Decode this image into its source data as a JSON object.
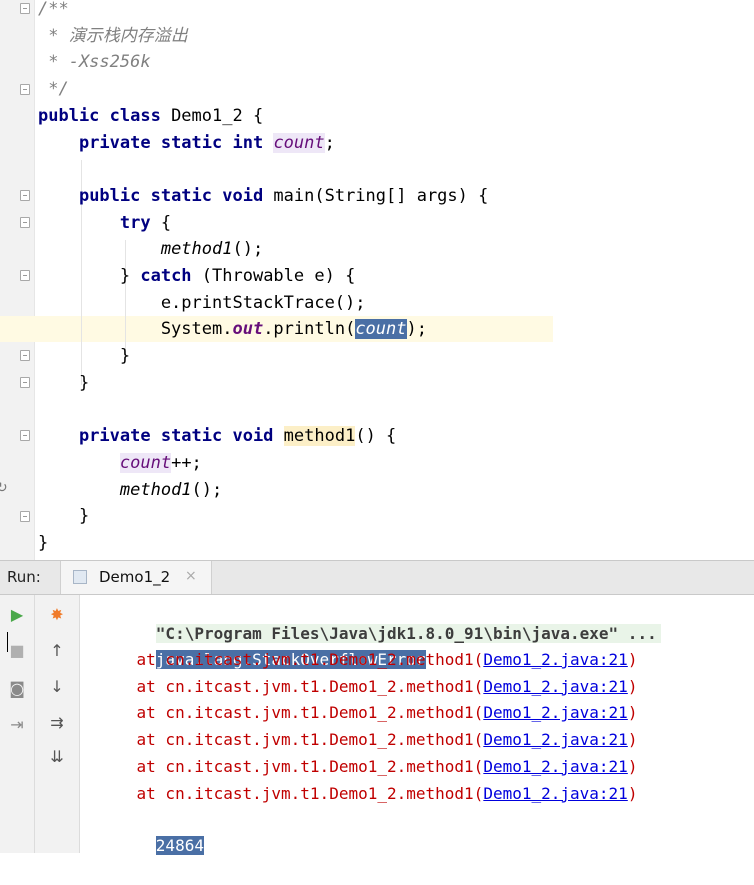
{
  "editor": {
    "lines": [
      {
        "parts": [
          {
            "t": "/**",
            "c": "cm"
          }
        ]
      },
      {
        "parts": [
          {
            "t": " * 演示栈内存溢出",
            "c": "cm"
          }
        ]
      },
      {
        "parts": [
          {
            "t": " * -Xss256k",
            "c": "cm"
          }
        ]
      },
      {
        "parts": [
          {
            "t": " */",
            "c": "cm"
          }
        ]
      },
      {
        "parts": [
          {
            "t": "public class",
            "c": "kw"
          },
          {
            "t": " Demo1_2 {",
            "c": ""
          }
        ]
      },
      {
        "parts": [
          {
            "t": "    ",
            "c": ""
          },
          {
            "t": "private static int",
            "c": "kw"
          },
          {
            "t": " ",
            "c": ""
          },
          {
            "t": "count",
            "c": "fld fld-hl"
          },
          {
            "t": ";",
            "c": ""
          }
        ]
      },
      {
        "parts": []
      },
      {
        "parts": [
          {
            "t": "    ",
            "c": ""
          },
          {
            "t": "public static void",
            "c": "kw"
          },
          {
            "t": " main(String[] args) {",
            "c": ""
          }
        ]
      },
      {
        "parts": [
          {
            "t": "        ",
            "c": ""
          },
          {
            "t": "try",
            "c": "kw"
          },
          {
            "t": " {",
            "c": ""
          }
        ]
      },
      {
        "parts": [
          {
            "t": "            ",
            "c": ""
          },
          {
            "t": "method1",
            "c": "mth"
          },
          {
            "t": "();",
            "c": ""
          }
        ]
      },
      {
        "parts": [
          {
            "t": "        } ",
            "c": ""
          },
          {
            "t": "catch",
            "c": "kw"
          },
          {
            "t": " (Throwable e) {",
            "c": ""
          }
        ]
      },
      {
        "parts": [
          {
            "t": "            e.printStackTrace();",
            "c": ""
          }
        ]
      },
      {
        "parts": [
          {
            "t": "            System.",
            "c": ""
          },
          {
            "t": "out",
            "c": "sfld"
          },
          {
            "t": ".println(",
            "c": ""
          },
          {
            "t": "count",
            "c": "sel"
          },
          {
            "t": ");",
            "c": ""
          }
        ]
      },
      {
        "parts": [
          {
            "t": "        }",
            "c": ""
          }
        ]
      },
      {
        "parts": [
          {
            "t": "    }",
            "c": ""
          }
        ]
      },
      {
        "parts": []
      },
      {
        "parts": [
          {
            "t": "    ",
            "c": ""
          },
          {
            "t": "private static void",
            "c": "kw"
          },
          {
            "t": " ",
            "c": ""
          },
          {
            "t": "method1",
            "c": "decl-hl"
          },
          {
            "t": "() {",
            "c": ""
          }
        ]
      },
      {
        "parts": [
          {
            "t": "        ",
            "c": ""
          },
          {
            "t": "count",
            "c": "fld fld-hl"
          },
          {
            "t": "++;",
            "c": ""
          }
        ]
      },
      {
        "parts": [
          {
            "t": "        ",
            "c": ""
          },
          {
            "t": "method1",
            "c": "mth"
          },
          {
            "t": "();",
            "c": ""
          }
        ]
      },
      {
        "parts": [
          {
            "t": "    }",
            "c": ""
          }
        ]
      },
      {
        "parts": [
          {
            "t": "}",
            "c": ""
          }
        ]
      }
    ]
  },
  "run_panel": {
    "label": "Run:",
    "tab_label": "Demo1_2",
    "tab_close": "×"
  },
  "console": {
    "command": "\"C:\\Program Files\\Java\\jdk1.8.0_91\\bin\\java.exe\" ...",
    "error": "java.lang.StackOverflowError",
    "trace_prefix": "    at cn.itcast.jvm.t1.Demo1_2.method1(",
    "trace_link": "Demo1_2.java:21",
    "trace_suffix": ")",
    "trace_count": 6,
    "output": "24864"
  },
  "toolbar": {
    "run_icon": "▶",
    "stop_icon": "■",
    "camera_icon": "◙",
    "login_icon": "⇥",
    "debug_icon": "✸",
    "up_icon": "↑",
    "down_icon": "↓",
    "wrap_icon": "⇉",
    "sort_icon": "⇊"
  }
}
